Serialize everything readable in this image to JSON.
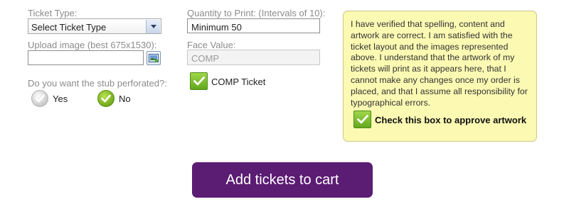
{
  "ticket_type": {
    "label": "Ticket Type:",
    "selected": "Select Ticket Type"
  },
  "upload": {
    "label": "Upload image (best 675x1530):",
    "value": "",
    "button_icon": "image-upload-icon"
  },
  "stub": {
    "question": "Do you want the stub perforated?:",
    "options": [
      {
        "label": "Yes",
        "selected": false
      },
      {
        "label": "No",
        "selected": true
      }
    ]
  },
  "quantity": {
    "label": "Quantity to Print: (Intervals of 10):",
    "value": "Minimum 50"
  },
  "face_value": {
    "label": "Face Value:",
    "value": "COMP"
  },
  "comp_ticket": {
    "label": "COMP Ticket",
    "checked": true
  },
  "approval": {
    "text": "I have verified that spelling, content and artwork are correct. I am satisfied with the ticket layout and the images represented above. I understand that the artwork of my tickets will print as it appears here, that I cannot make any changes once my order is placed, and that I assume all responsibility for typographical errors.",
    "checkbox_label": "Check this box to approve artwork",
    "checked": true
  },
  "cart": {
    "button_label": "Add tickets to cart"
  },
  "colors": {
    "note_background": "#fbf9b2",
    "cart_button": "#5b1c73",
    "check_green": "#6fb52a"
  }
}
